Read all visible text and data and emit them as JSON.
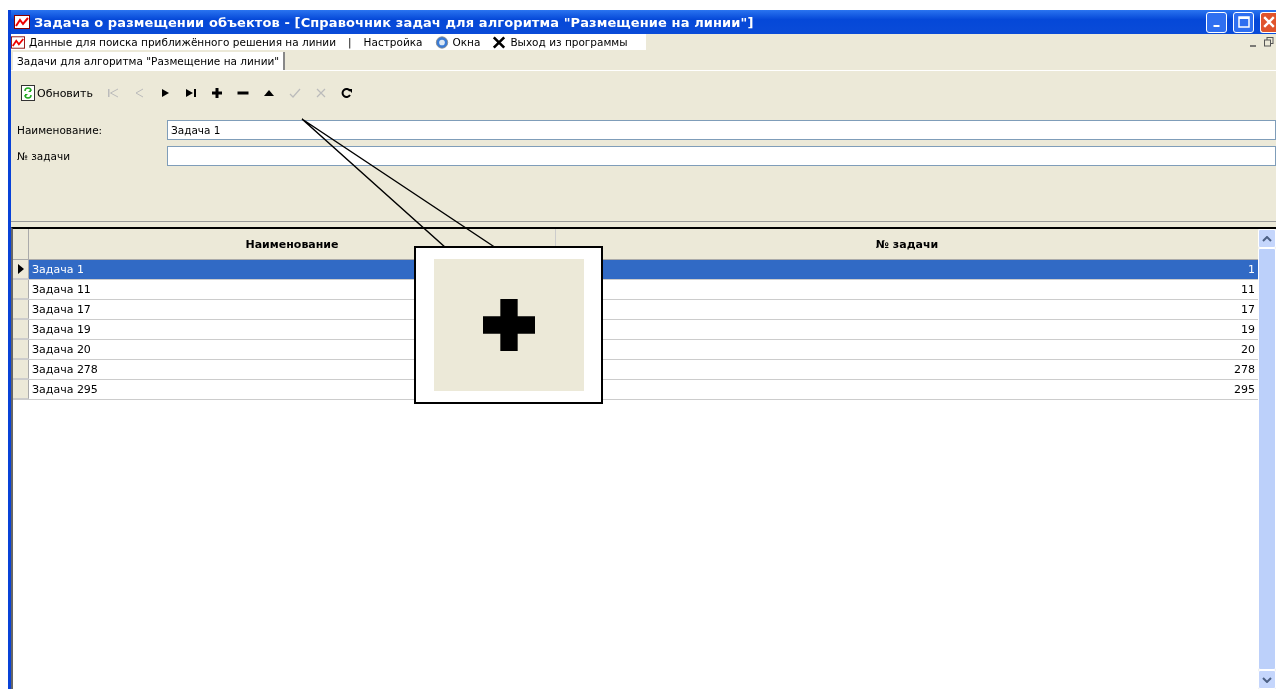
{
  "window": {
    "title": "Задача о размещении объектов - [Справочник задач для алгоритма \"Размещение на линии\"]"
  },
  "menu": [
    {
      "kind": "chart",
      "label": "Данные для поиска приближённого решения на линии"
    },
    {
      "kind": "separator",
      "label": "|"
    },
    {
      "kind": "plain",
      "label": "Настройка"
    },
    {
      "kind": "globe",
      "label": "Окна"
    },
    {
      "kind": "cross",
      "label": "Выход из программы"
    }
  ],
  "tabs": [
    {
      "label": "Задачи для алгоритма \"Размещение на линии\"",
      "selected": true
    }
  ],
  "toolbar": [
    {
      "kind": "refresh",
      "label": "Обновить",
      "disabled": false
    },
    {
      "kind": "first",
      "disabled": true
    },
    {
      "kind": "prior",
      "disabled": true
    },
    {
      "kind": "next",
      "disabled": false
    },
    {
      "kind": "last",
      "disabled": false
    },
    {
      "kind": "insert",
      "disabled": false
    },
    {
      "kind": "delete",
      "disabled": false
    },
    {
      "kind": "edit",
      "disabled": false
    },
    {
      "kind": "post",
      "disabled": true
    },
    {
      "kind": "cancel",
      "disabled": true
    },
    {
      "kind": "reload",
      "disabled": false
    }
  ],
  "form": [
    {
      "label": "Наименование:",
      "value": "Задача 1"
    },
    {
      "label": "№ задачи"
    }
  ],
  "table": {
    "columns": [
      "Наименование",
      "№ задачи"
    ],
    "rows": [
      {
        "name": "Задача 1",
        "number": "1",
        "selected": true
      },
      {
        "name": "Задача 11",
        "number": "11",
        "selected": false
      },
      {
        "name": "Задача 17",
        "number": "17",
        "selected": false
      },
      {
        "name": "Задача 19",
        "number": "19",
        "selected": false
      },
      {
        "name": "Задача 20",
        "number": "20",
        "selected": false
      },
      {
        "name": "Задача 278",
        "number": "278",
        "selected": false
      },
      {
        "name": "Задача 295",
        "number": "295",
        "selected": false
      }
    ]
  }
}
